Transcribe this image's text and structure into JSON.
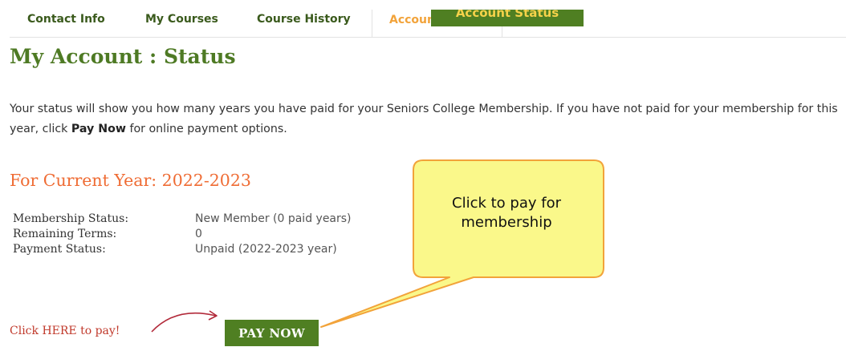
{
  "tabs": [
    {
      "label": "Contact Info",
      "active": false
    },
    {
      "label": "My Courses",
      "active": false
    },
    {
      "label": "Course History",
      "active": false
    },
    {
      "label": "Account Status",
      "active": true
    }
  ],
  "tab_tooltip": "Account Status",
  "page_title": "My Account : Status",
  "intro": {
    "before": "Your status will show you how many years you have paid for your Seniors College Membership. If you have not paid for your membership for this year, click ",
    "bold": "Pay Now",
    "after": " for online payment options."
  },
  "year_heading": "For Current Year: 2022-2023",
  "status_rows": [
    {
      "label": "Membership Status:",
      "value": "New Member (0 paid years)"
    },
    {
      "label": "Remaining Terms:",
      "value": "0"
    },
    {
      "label": "Payment Status:",
      "value": "Unpaid (2022-2023 year)"
    }
  ],
  "pay_prompt": "Click HERE to pay!",
  "pay_button_label": "PAY NOW",
  "callout": {
    "text_line1": "Click to pay for",
    "text_line2": "membership"
  },
  "colors": {
    "brand_green": "#4f7f22",
    "title_green": "#4e7a24",
    "accent_orange": "#ef6c34",
    "tab_active": "#f2a33a",
    "callout_fill": "#faf88a",
    "callout_border": "#f2a33a",
    "prompt_red": "#c0392b"
  },
  "icons": {
    "pay_arrow": "curved-arrow-icon"
  }
}
